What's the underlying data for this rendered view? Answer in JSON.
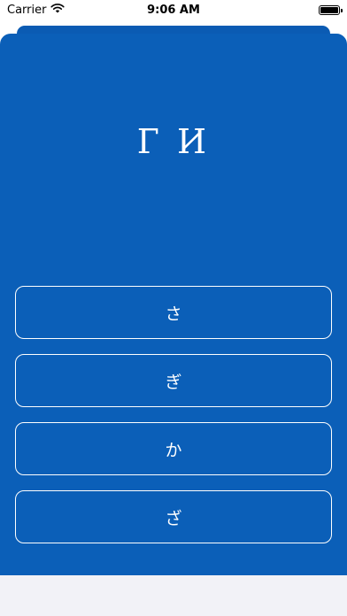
{
  "status": {
    "carrier": "Carrier",
    "time": "9:06 AM"
  },
  "quiz": {
    "question": "Г И",
    "options": [
      "さ",
      "ぎ",
      "か",
      "ざ"
    ]
  },
  "colors": {
    "card": "#0b5fb8",
    "text": "#ffffff"
  }
}
